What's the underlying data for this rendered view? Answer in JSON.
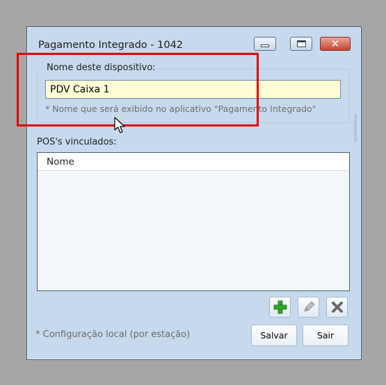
{
  "window": {
    "title": "Pagamento Integrado - 1042",
    "controls": {
      "minimize_icon": "minimize-icon",
      "maximize_icon": "maximize-icon",
      "close_icon": "close-icon"
    }
  },
  "device": {
    "group_label": "Nome deste dispositivo:",
    "name_value": "PDV Caixa 1",
    "hint": "* Nome que será exibido no aplicativo \"Pagamento Integrado\""
  },
  "pos": {
    "label": "POS's vinculados:",
    "columns": [
      "Nome"
    ],
    "rows": []
  },
  "actions": {
    "add_icon": "plus-icon",
    "edit_icon": "pencil-icon",
    "delete_icon": "x-icon"
  },
  "footer": {
    "note": "* Configuração local (por estação)",
    "save_label": "Salvar",
    "exit_label": "Sair"
  },
  "colors": {
    "annotation": "#e00000",
    "input_background": "#fefdd6",
    "window_background": "#c7d9ec"
  }
}
